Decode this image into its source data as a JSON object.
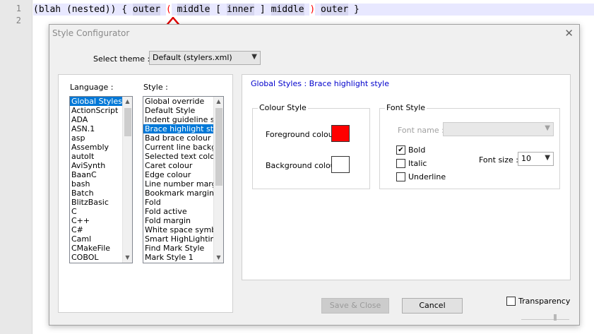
{
  "editor": {
    "line_numbers": [
      "1",
      "2"
    ],
    "line1_tokens": [
      {
        "text": "(blah (nested)) { ",
        "style": "plain"
      },
      {
        "text": "outer",
        "style": "hl"
      },
      {
        "text": " ",
        "style": "plain"
      },
      {
        "text": "(",
        "style": "brace-hl"
      },
      {
        "text": " ",
        "style": "plain"
      },
      {
        "text": "middle",
        "style": "hl"
      },
      {
        "text": " [ ",
        "style": "plain"
      },
      {
        "text": "inner",
        "style": "hl"
      },
      {
        "text": " ] ",
        "style": "plain"
      },
      {
        "text": "middle",
        "style": "hl"
      },
      {
        "text": " ",
        "style": "plain"
      },
      {
        "text": ")",
        "style": "brace-hl"
      },
      {
        "text": " ",
        "style": "plain"
      },
      {
        "text": "outer",
        "style": "hl"
      },
      {
        "text": " }",
        "style": "plain"
      }
    ],
    "arrow_color": "#e00000"
  },
  "dialog": {
    "title": "Style Configurator",
    "close_glyph": "✕",
    "select_theme_label": "Select theme :",
    "theme_value": "Default (stylers.xml)",
    "language_label": "Language :",
    "style_label": "Style :",
    "languages": [
      "Global Styles",
      "ActionScript",
      "ADA",
      "ASN.1",
      "asp",
      "Assembly",
      "autoIt",
      "AviSynth",
      "BaanC",
      "bash",
      "Batch",
      "BlitzBasic",
      "C",
      "C++",
      "C#",
      "Caml",
      "CMakeFile",
      "COBOL"
    ],
    "selected_language": "Global Styles",
    "styles": [
      "Global override",
      "Default Style",
      "Indent guideline style",
      "Brace highlight style",
      "Bad brace colour",
      "Current line background colour",
      "Selected text colour",
      "Caret colour",
      "Edge colour",
      "Line number margin",
      "Bookmark margin",
      "Fold",
      "Fold active",
      "Fold margin",
      "White space symbol",
      "Smart HighLighting",
      "Find Mark Style",
      "Mark Style 1"
    ],
    "selected_style": "Brace highlight style",
    "section_title": "Global Styles : Brace highlight style",
    "colour_style": {
      "legend": "Colour Style",
      "foreground_label": "Foreground colour",
      "foreground_color": "#ff0000",
      "background_label": "Background colour",
      "background_color": "#ffffff"
    },
    "font_style": {
      "legend": "Font Style",
      "font_name_label": "Font name :",
      "font_name_value": "",
      "bold_label": "Bold",
      "bold": true,
      "italic_label": "Italic",
      "italic": false,
      "underline_label": "Underline",
      "underline": false,
      "font_size_label": "Font size :",
      "font_size_value": "10"
    },
    "save_close_label": "Save & Close",
    "cancel_label": "Cancel",
    "transparency_label": "Transparency",
    "transparency": false
  }
}
